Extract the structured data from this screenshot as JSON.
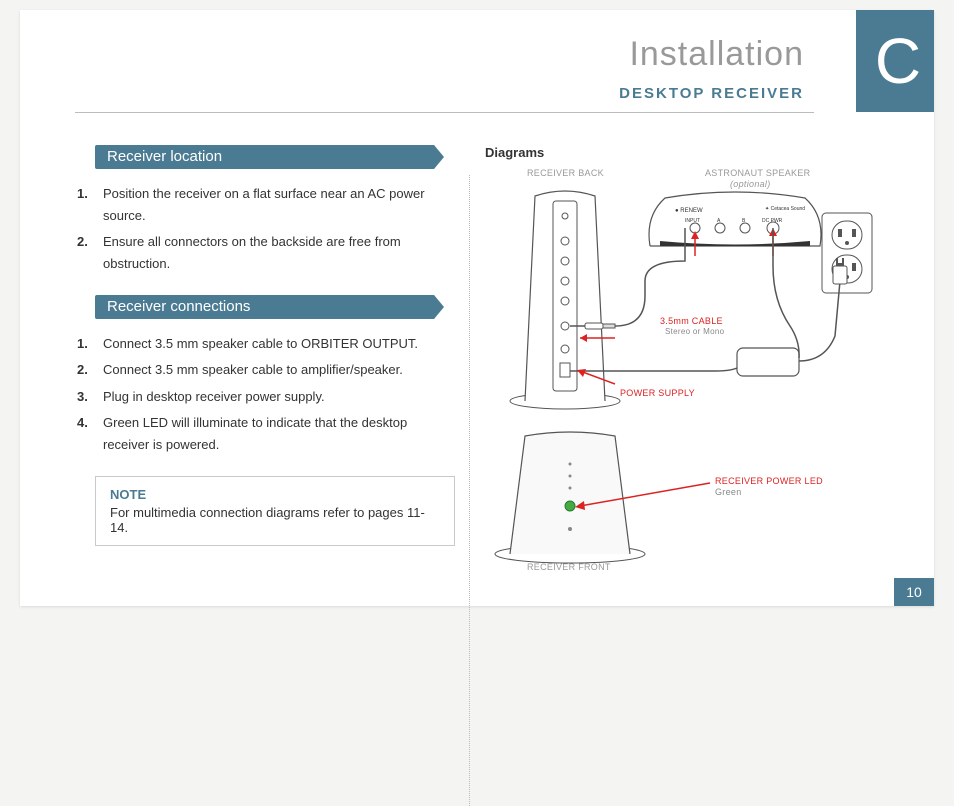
{
  "header": {
    "title": "Installation",
    "subtitle": "DESKTOP RECEIVER",
    "section_letter": "C"
  },
  "page_number": "10",
  "sections": {
    "location": {
      "title": "Receiver location",
      "steps": [
        "Position the receiver on a flat surface near an AC power source.",
        "Ensure all connectors on the backside are free from obstruction."
      ]
    },
    "connections": {
      "title": "Receiver connections",
      "steps": [
        "Connect 3.5 mm speaker cable to ORBITER OUTPUT.",
        "Connect 3.5 mm speaker cable to amplifier/speaker.",
        "Plug in desktop receiver power supply.",
        "Green LED will illuminate to indicate that the desktop receiver is powered."
      ]
    }
  },
  "note": {
    "label": "NOTE",
    "text": "For multimedia connection diagrams refer to pages 11-14."
  },
  "diagrams": {
    "heading": "Diagrams",
    "labels": {
      "receiver_back": "RECEIVER BACK",
      "astronaut_speaker": "ASTRONAUT SPEAKER",
      "optional": "(optional)",
      "cable": "3.5mm CABLE",
      "cable_sub": "Stereo or Mono",
      "power_supply": "POWER SUPPLY",
      "receiver_front": "RECEIVER FRONT",
      "power_led": "RECEIVER POWER LED",
      "power_led_sub": "Green",
      "speaker_ports": {
        "renew": "RENEW",
        "input": "INPUT",
        "a": "A",
        "b": "B",
        "dcpwr": "DC PWR"
      }
    }
  }
}
